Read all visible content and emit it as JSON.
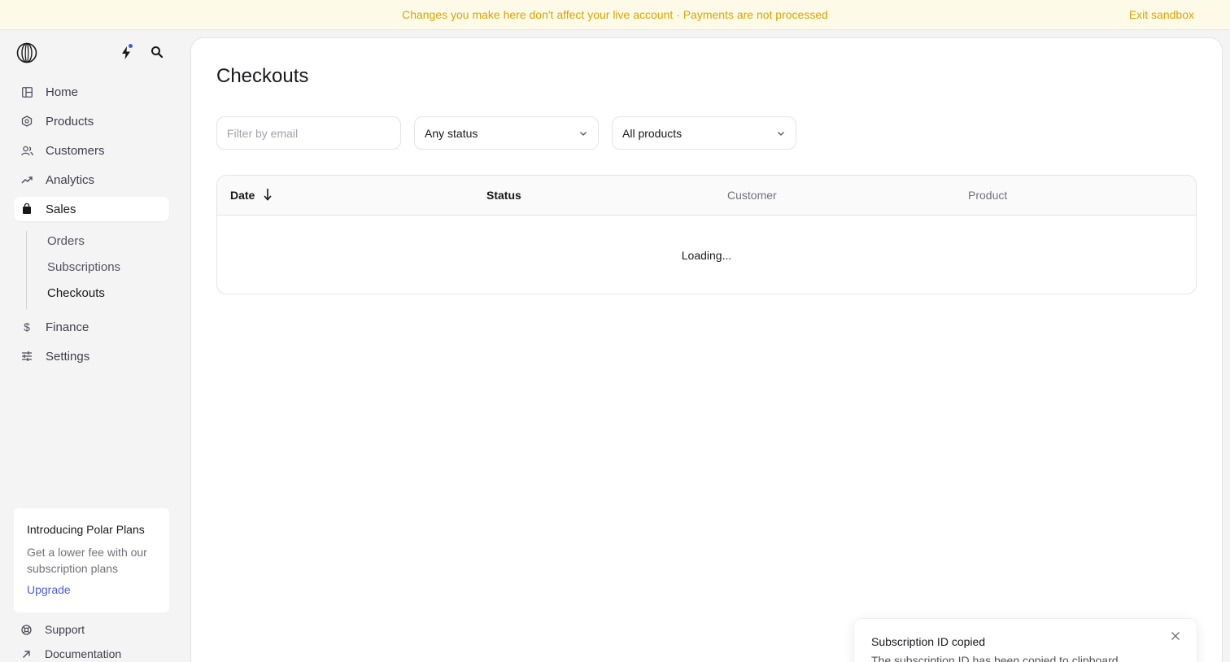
{
  "banner": {
    "message": "Changes you make here don't affect your live account · Payments are not processed",
    "exit_label": "Exit sandbox"
  },
  "sidebar": {
    "nav": [
      {
        "label": "Home",
        "icon": "layout-icon"
      },
      {
        "label": "Products",
        "icon": "hexagon-icon"
      },
      {
        "label": "Customers",
        "icon": "users-icon"
      },
      {
        "label": "Analytics",
        "icon": "trend-icon"
      },
      {
        "label": "Sales",
        "icon": "shopping-bag-icon",
        "active": true
      },
      {
        "label": "Finance",
        "icon": "dollar-icon"
      },
      {
        "label": "Settings",
        "icon": "sliders-icon"
      }
    ],
    "sales_subnav": [
      {
        "label": "Orders"
      },
      {
        "label": "Subscriptions"
      },
      {
        "label": "Checkouts",
        "active": true
      }
    ],
    "promo": {
      "title": "Introducing Polar Plans",
      "description": "Get a lower fee with our subscription plans",
      "link": "Upgrade"
    },
    "bottom_links": [
      {
        "label": "Support",
        "icon": "lifebuoy-icon"
      },
      {
        "label": "Documentation",
        "icon": "arrow-up-right-icon"
      }
    ]
  },
  "main": {
    "title": "Checkouts",
    "filters": {
      "email_placeholder": "Filter by email",
      "email_value": "",
      "status_selected": "Any status",
      "product_selected": "All products"
    },
    "table": {
      "columns": [
        "Date",
        "Status",
        "Customer",
        "Product"
      ],
      "sort_column": "Date",
      "sort_direction": "desc",
      "loading_text": "Loading..."
    }
  },
  "toast": {
    "title": "Subscription ID copied",
    "description": "The subscription ID has been copied to clipboard"
  },
  "colors": {
    "banner_text": "#d8a400",
    "accent": "#4c5ce0",
    "notification_dot": "#3b5bdb"
  }
}
